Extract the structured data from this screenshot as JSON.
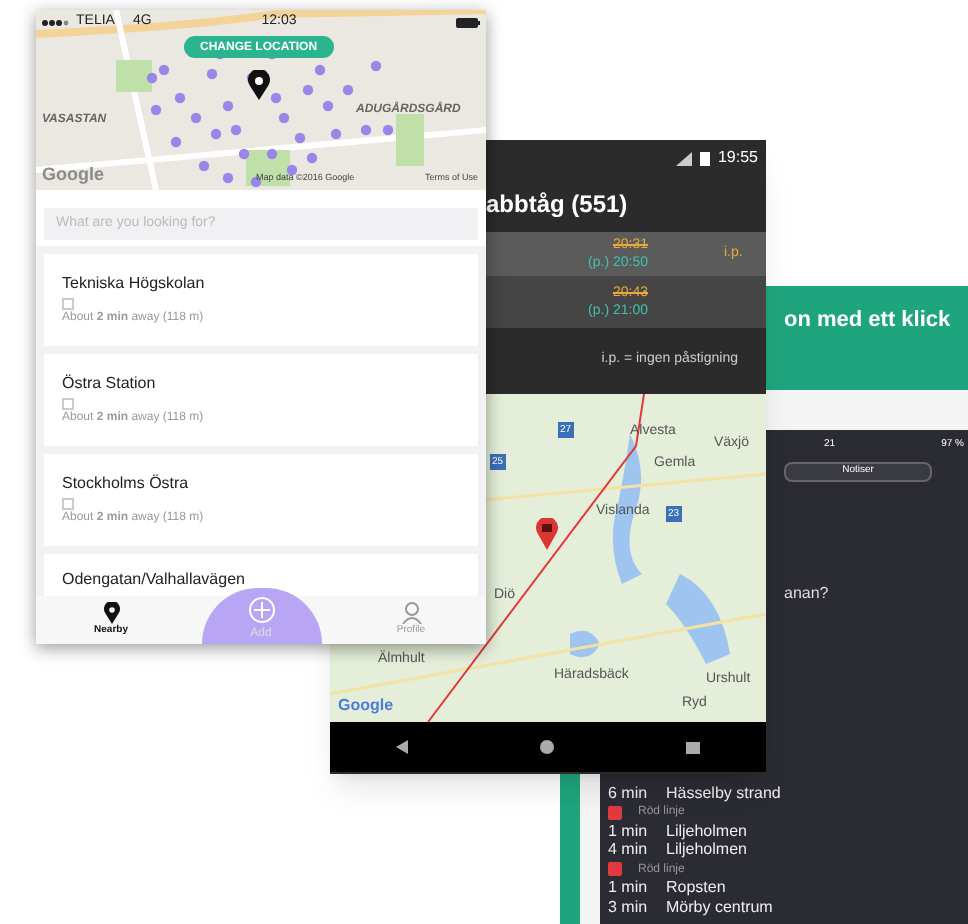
{
  "promo": {
    "headline": "on med ett klick",
    "phone": {
      "time": "21",
      "battery": "97 %",
      "button": "Notiser",
      "question": "anan?",
      "departures": [
        {
          "kind": "row",
          "minutes": "6 min",
          "destination": "Hässelby strand"
        },
        {
          "kind": "line",
          "label": "Röd linje",
          "color": "#e0393e"
        },
        {
          "kind": "row",
          "minutes": "1 min",
          "destination": "Liljeholmen"
        },
        {
          "kind": "row",
          "minutes": "4 min",
          "destination": "Liljeholmen"
        },
        {
          "kind": "line",
          "label": "Röd linje",
          "color": "#e0393e"
        },
        {
          "kind": "row",
          "minutes": "1 min",
          "destination": "Ropsten"
        },
        {
          "kind": "row",
          "minutes": "3 min",
          "destination": "Mörby centrum"
        }
      ]
    }
  },
  "train_app": {
    "time": "19:55",
    "title": "abbtåg (551)",
    "departures": [
      {
        "scheduled": "20:31",
        "new_time": "(p.) 20:50",
        "note": "i.p.",
        "selected": true
      },
      {
        "scheduled": "20:43",
        "new_time": "(p.) 21:00",
        "selected": false
      }
    ],
    "legend": "i.p. = ingen påstigning",
    "map": {
      "places": [
        "Alvesta",
        "Växjö",
        "Gemla",
        "Vislanda",
        "Diö",
        "Älmhult",
        "Häradsbäck",
        "Urshult",
        "Ryd"
      ],
      "roads": [
        "27",
        "25",
        "23"
      ],
      "logo": "Google"
    }
  },
  "nearby_app": {
    "status_bar": {
      "carrier": "TELIA",
      "network": "4G",
      "time": "12:03"
    },
    "map": {
      "button": "CHANGE LOCATION",
      "labels": [
        "VASASTAN",
        "ADUGÅRDSGÅRD"
      ],
      "attribution": "Map data ©2016 Google",
      "terms": "Terms of Use",
      "logo": "Google"
    },
    "search": {
      "placeholder": "What are you looking for?"
    },
    "places": [
      {
        "name": "Tekniska Högskolan",
        "checked": false,
        "distance": "About **2 min** away (118 m)"
      },
      {
        "name": "Östra Station",
        "checked": false,
        "distance": "About **2 min** away (118 m)"
      },
      {
        "name": "Stockholms Östra",
        "checked": false,
        "distance": "About **2 min** away (118 m)"
      },
      {
        "name": "Odengatan/Valhallavägen"
      }
    ],
    "tabs": [
      {
        "kind": "pin",
        "label": "Nearby",
        "selected": true
      },
      {
        "kind": "add",
        "label": "Add",
        "selected": false
      },
      {
        "kind": "person",
        "label": "Profile",
        "selected": false
      }
    ]
  }
}
